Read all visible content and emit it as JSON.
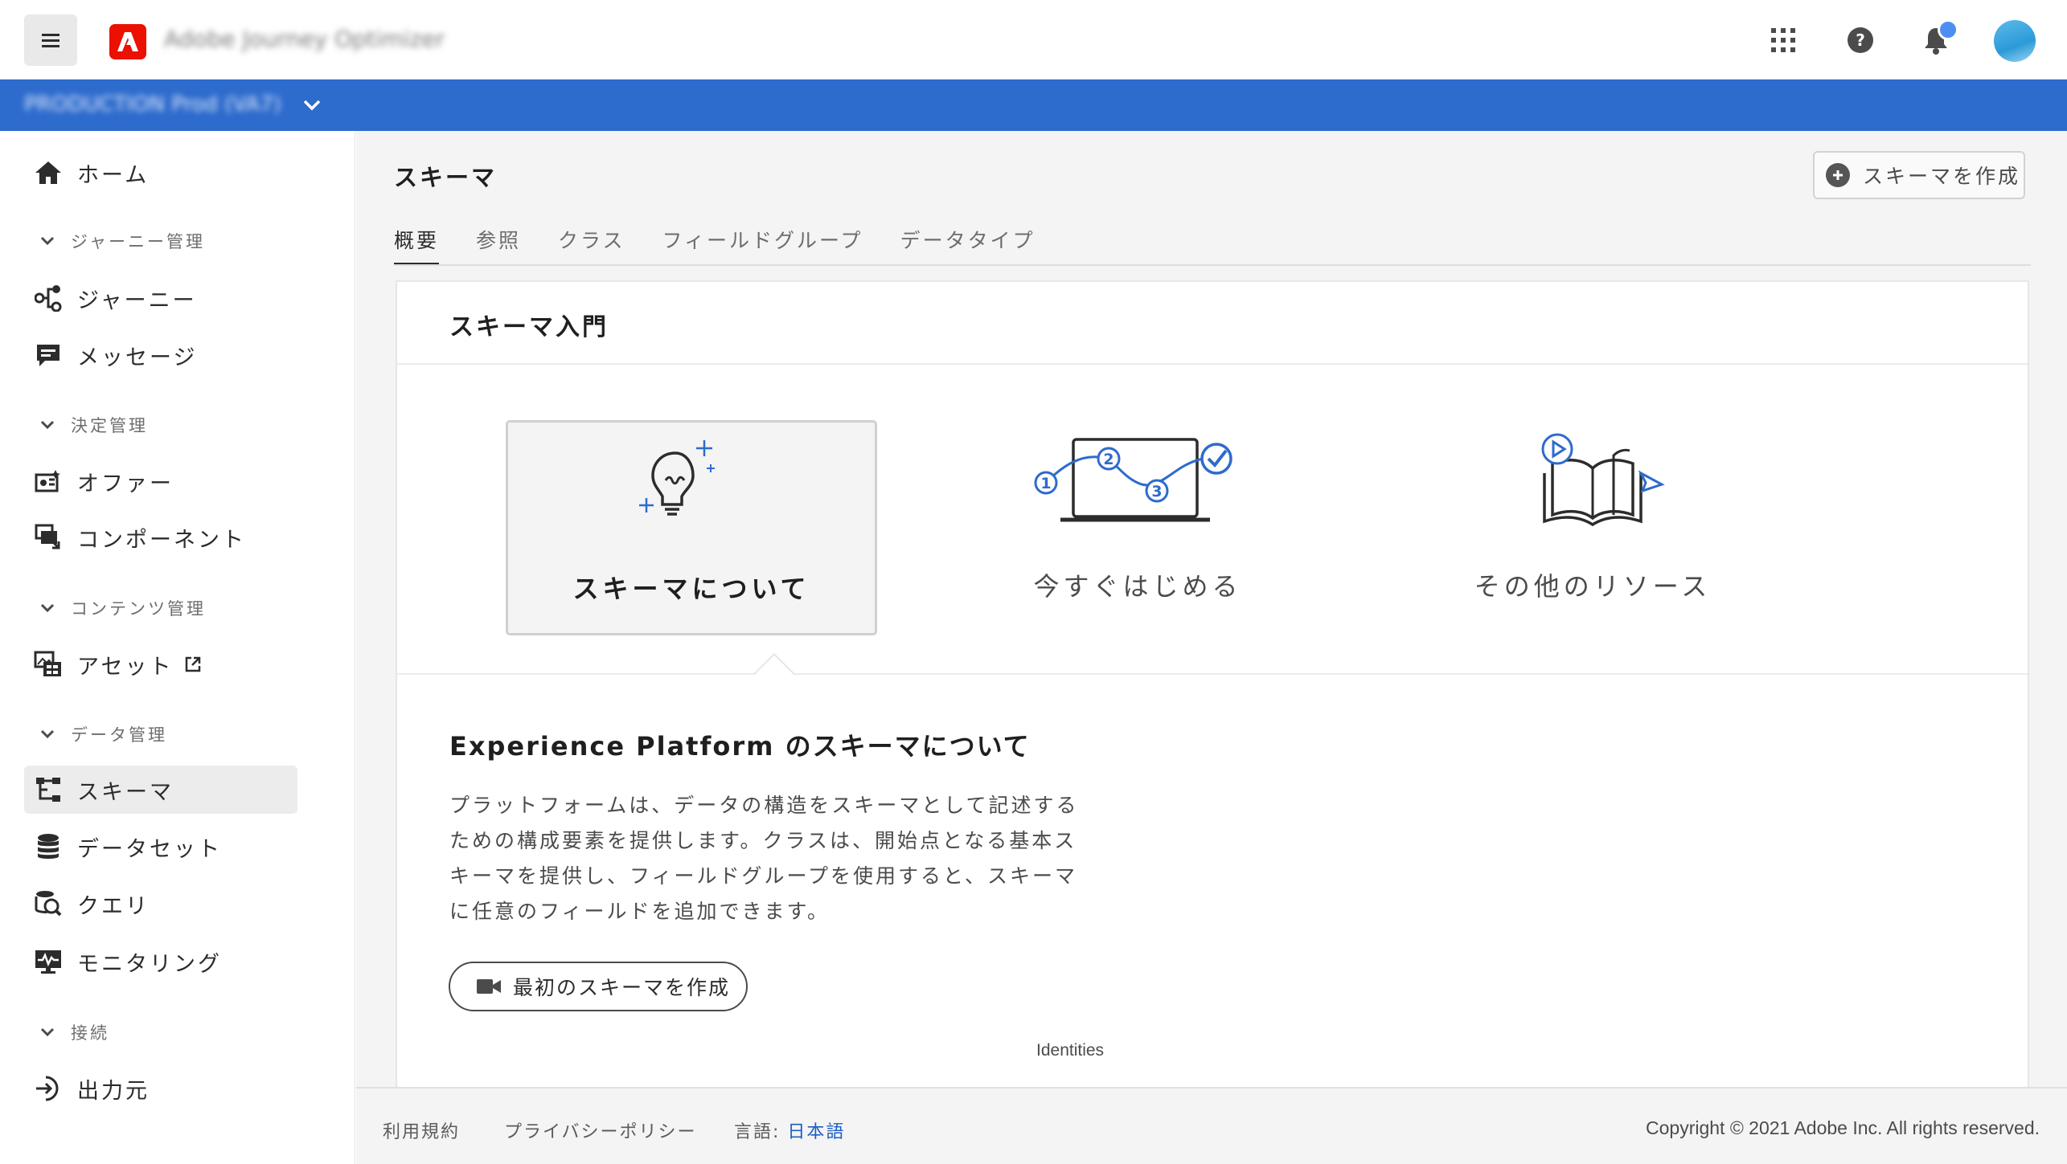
{
  "topbar": {
    "menu_label": "Menu",
    "app_name": "Adobe Journey Optimizer",
    "icons": [
      "apps-icon",
      "help-icon",
      "bell-icon",
      "avatar"
    ]
  },
  "orgbar": {
    "org_text": "PRODUCTION Prod (VA7)"
  },
  "sidebar": {
    "home": "ホーム",
    "sections": {
      "journey": "ジャーニー管理",
      "decision": "決定管理",
      "content": "コンテンツ管理",
      "data": "データ管理",
      "connections": "接続"
    },
    "items": {
      "journeys": "ジャーニー",
      "messages": "メッセージ",
      "offers": "オファー",
      "components": "コンポーネント",
      "assets": "アセット",
      "schemas": "スキーマ",
      "datasets": "データセット",
      "queries": "クエリ",
      "monitoring": "モニタリング",
      "destinations": "出力元"
    }
  },
  "main": {
    "title": "スキーマ",
    "create_button": "スキーマを作成",
    "tabs": [
      "概要",
      "参照",
      "クラス",
      "フィールドグループ",
      "データタイプ"
    ],
    "active_tab": "概要",
    "card": {
      "title": "スキーマ入門",
      "options": [
        "スキーマについて",
        "今すぐはじめる",
        "その他のリソース"
      ],
      "selected_option": "スキーマについて",
      "section_heading": "Experience Platform のスキーマについて",
      "description": "プラットフォームは、データの構造をスキーマとして記述するための構成要素を提供します。クラスは、開始点となる基本スキーマを提供し、フィールドグループを使用すると、スキーマに任意のフィールドを追加できます。",
      "video_button": "最初のスキーマを作成",
      "caption": "Identities"
    }
  },
  "footer": {
    "terms": "利用規約",
    "privacy": "プライバシーポリシー",
    "language_label": "言語:",
    "language_value": "日本語",
    "copyright": "Copyright © 2021 Adobe Inc. All rights reserved."
  },
  "colors": {
    "brand_red": "#eb1000",
    "org_bar_blue": "#2d6bcd",
    "link_blue": "#1b5fc4",
    "illustration_blue": "#2d6bcd",
    "notification_dot": "#4d8ef2"
  }
}
